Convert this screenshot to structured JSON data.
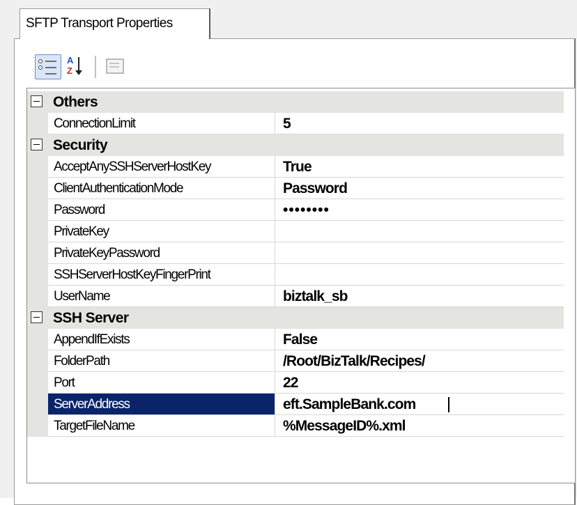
{
  "window": {
    "tab_label": "SFTP Transport Properties"
  },
  "toolbar": {
    "buttons": [
      {
        "icon": "categorized-view-icon",
        "pressed": true
      },
      {
        "icon": "alphabetical-sort-icon",
        "pressed": false
      },
      {
        "icon": "property-pages-icon",
        "enabled": false
      }
    ]
  },
  "grid": {
    "categories": [
      {
        "label": "Others",
        "expanded": true,
        "properties": [
          {
            "name": "ConnectionLimit",
            "value": "5"
          }
        ]
      },
      {
        "label": "Security",
        "expanded": true,
        "properties": [
          {
            "name": "AcceptAnySSHServerHostKey",
            "value": "True"
          },
          {
            "name": "ClientAuthenticationMode",
            "value": "Password"
          },
          {
            "name": "Password",
            "value": "••••••••"
          },
          {
            "name": "PrivateKey",
            "value": ""
          },
          {
            "name": "PrivateKeyPassword",
            "value": ""
          },
          {
            "name": "SSHServerHostKeyFingerPrint",
            "value": ""
          },
          {
            "name": "UserName",
            "value": "biztalk_sb"
          }
        ]
      },
      {
        "label": "SSH Server",
        "expanded": true,
        "properties": [
          {
            "name": "AppendIfExists",
            "value": "False"
          },
          {
            "name": "FolderPath",
            "value": "/Root/BizTalk/Recipes/"
          },
          {
            "name": "Port",
            "value": "22"
          },
          {
            "name": "ServerAddress",
            "value": "eft.SampleBank.com",
            "selected": true
          },
          {
            "name": "TargetFileName",
            "value": "%MessageID%.xml"
          }
        ]
      }
    ]
  },
  "colors": {
    "selection": "#0a246a",
    "category_background": "#e4e4e0",
    "grid_line": "#d7d7d3"
  }
}
